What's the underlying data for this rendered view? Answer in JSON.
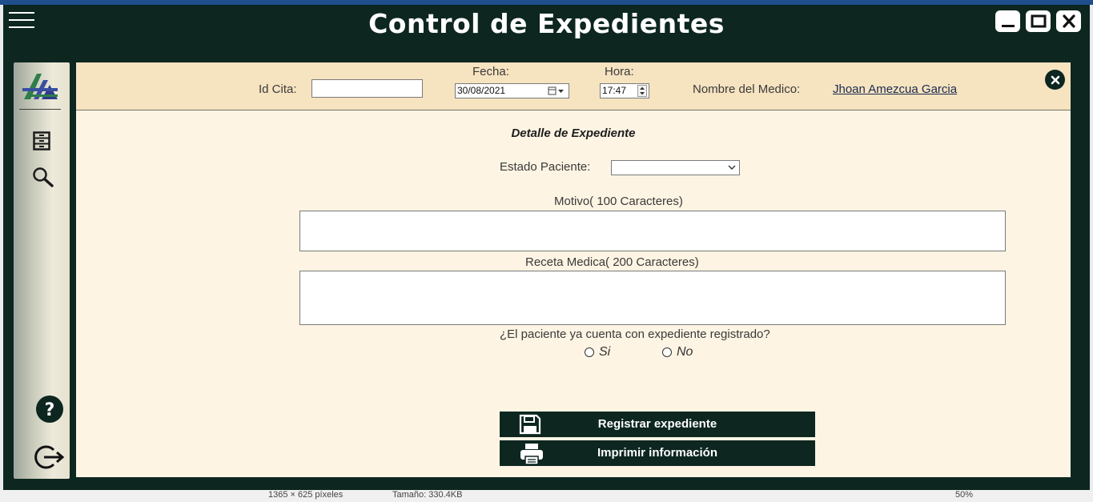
{
  "window": {
    "title": "Control de Expedientes",
    "controls": [
      "minimize-icon",
      "maximize-icon",
      "close-icon"
    ]
  },
  "sidebar": {
    "items": [
      {
        "name": "logo",
        "icon": "app-logo"
      },
      {
        "name": "expedientes",
        "icon": "file-cabinet-icon"
      },
      {
        "name": "buscar",
        "icon": "search-icon"
      },
      {
        "name": "ayuda",
        "icon": "help-icon"
      },
      {
        "name": "salir",
        "icon": "logout-icon"
      }
    ]
  },
  "header": {
    "id_cita_label": "Id Cita:",
    "id_cita_value": "",
    "fecha_label": "Fecha:",
    "fecha_value": "30/08/2021",
    "hora_label": "Hora:",
    "hora_value": "17:47",
    "medico_label": "Nombre del Medico:",
    "medico_name": "Jhoan Amezcua Garcia"
  },
  "form": {
    "title": "Detalle de Expediente",
    "estado_label": "Estado Paciente:",
    "estado_value": "",
    "motivo_label": "Motivo( 100 Caracteres)",
    "motivo_value": "",
    "receta_label": "Receta Medica( 200 Caracteres)",
    "receta_value": "",
    "pregunta": "¿El paciente ya cuenta con expediente registrado?",
    "opcion_si": "Si",
    "opcion_no": "No"
  },
  "actions": {
    "registrar": "Registrar expediente",
    "imprimir": "Imprimir información"
  },
  "statusbar": {
    "dimensions": "1365 × 625 píxeles",
    "size": "Tamaño: 330.4KB",
    "zoom": "50%"
  },
  "colors": {
    "titlebar": "#0d2620",
    "header_bg": "#f6e3c0",
    "panel_bg": "#fdf4e3",
    "link": "#1a2a50"
  }
}
